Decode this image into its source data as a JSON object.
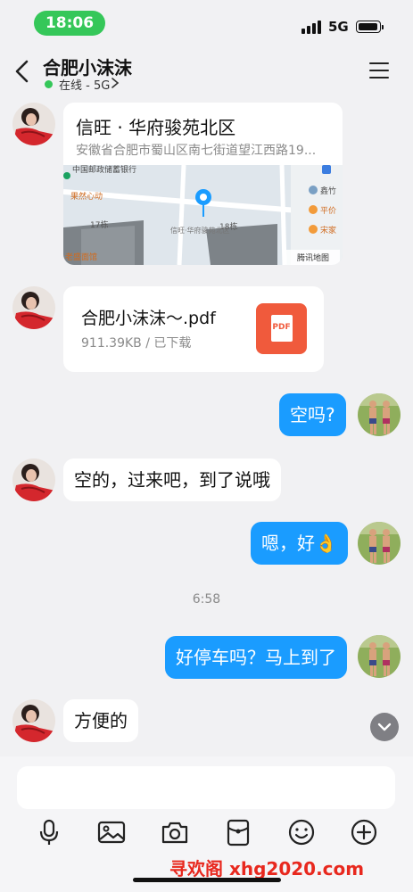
{
  "status_bar": {
    "time": "18:06",
    "network": "5G"
  },
  "header": {
    "contact_name": "合肥小沫沫",
    "status": "在线 - 5G"
  },
  "messages": {
    "location": {
      "name": "信旺 · 华府骏苑北区",
      "address": "安徽省合肥市蜀山区南七街道望江西路19...",
      "map_labels": [
        "中国邮政储蓄银行",
        "果然心动",
        "17栋",
        "18栋",
        "信旺·华府骏苑北区",
        "鑫竹",
        "平价",
        "宋家",
        "老盛面馆",
        "腾讯地图"
      ]
    },
    "file": {
      "name": "合肥小沫沫～.pdf",
      "meta": "911.39KB / 已下载",
      "badge": "PDF"
    },
    "m1_out": "空吗?",
    "m2_in": "空的，过来吧，到了说哦",
    "m3_out": "嗯，好👌",
    "time_sep": "6:58",
    "m4_out": "好停车吗？马上到了",
    "m5_in": "方便的"
  },
  "input": {
    "placeholder": ""
  },
  "watermark": "寻欢阁 xhg2020.com",
  "colors": {
    "accent": "#1a9cff",
    "online": "#35c759",
    "pdf": "#f05a3c"
  }
}
